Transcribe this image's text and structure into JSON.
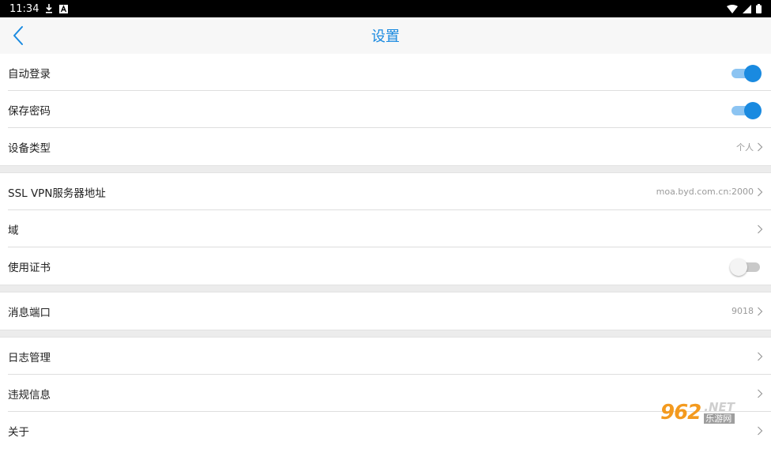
{
  "status_bar": {
    "time": "11:34"
  },
  "header": {
    "title": "设置"
  },
  "groups": [
    {
      "rows": [
        {
          "label": "自动登录",
          "toggle": "on"
        },
        {
          "label": "保存密码",
          "toggle": "on"
        },
        {
          "label": "设备类型",
          "value": "个人"
        }
      ]
    },
    {
      "rows": [
        {
          "label": "SSL VPN服务器地址",
          "value": "moa.byd.com.cn:2000"
        },
        {
          "label": "域"
        },
        {
          "label": "使用证书",
          "toggle": "off"
        }
      ]
    },
    {
      "rows": [
        {
          "label": "消息端口",
          "value": "9018"
        }
      ]
    },
    {
      "rows": [
        {
          "label": "日志管理"
        },
        {
          "label": "违规信息"
        },
        {
          "label": "关于"
        }
      ]
    }
  ],
  "watermark": {
    "number": "962",
    "suffix": ".NET",
    "site": "乐游网"
  },
  "colors": {
    "accent": "#1a8ae0",
    "toggle_track_on": "#8cc4f2"
  }
}
